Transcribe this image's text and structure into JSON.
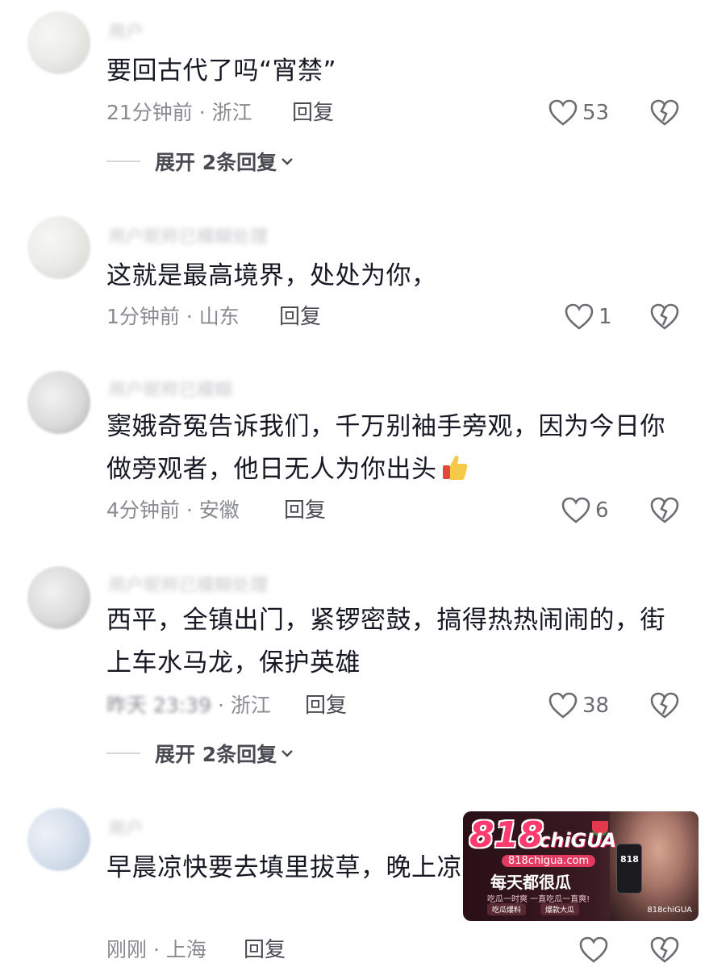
{
  "comments": [
    {
      "nickname": "用户",
      "text": "要回古代了吗“宵禁”",
      "time": "21分钟前",
      "location": "浙江",
      "reply_label": "回复",
      "likes": "53",
      "expand_label": "展开 2条回复"
    },
    {
      "nickname": "用户昵称已模糊处理",
      "text": "这就是最高境界，处处为你，",
      "time": "1分钟前",
      "location": "山东",
      "reply_label": "回复",
      "likes": "1"
    },
    {
      "nickname": "用户昵称已模糊",
      "text": "窦娥奇冤告诉我们，千万别袖手旁观，因为今日你做旁观者，他日无人为你出头",
      "time": "4分钟前",
      "location": "安徽",
      "reply_label": "回复",
      "likes": "6"
    },
    {
      "nickname": "用户昵称已模糊处理",
      "text": "西平，全镇出门，紧锣密鼓，搞得热热闹闹的，街上车水马龙，保护英雄",
      "time": "昨天 23:39",
      "location": "浙江",
      "reply_label": "回复",
      "likes": "38",
      "expand_label": "展开 2条回复"
    },
    {
      "nickname": "用户",
      "text": "早晨凉快要去填里拔草，晚上凉快要去林捉知了猴",
      "time": "刚刚",
      "location": "上海",
      "reply_label": "回复",
      "likes": ""
    }
  ],
  "separator": " · ",
  "ad": {
    "logo": "818",
    "brand": "chiGUA",
    "url": "818chigua.com",
    "slogan": "每天都很瓜",
    "sub": "吃瓜一时爽 一直吃瓜一直爽!",
    "badge1": "吃瓜爆料",
    "badge2": "爆款大瓜",
    "phone_text": "818",
    "corner": "818chiGUA"
  },
  "icons": {
    "like": "heart-outline-icon",
    "dislike": "broken-heart-icon",
    "expand": "chevron-down-icon",
    "thumbs_up_emoji": "thumbs-up-emoji"
  },
  "colors": {
    "text": "#161823",
    "meta": "#8a8b91",
    "accent_ad": "#ff3a6e"
  }
}
